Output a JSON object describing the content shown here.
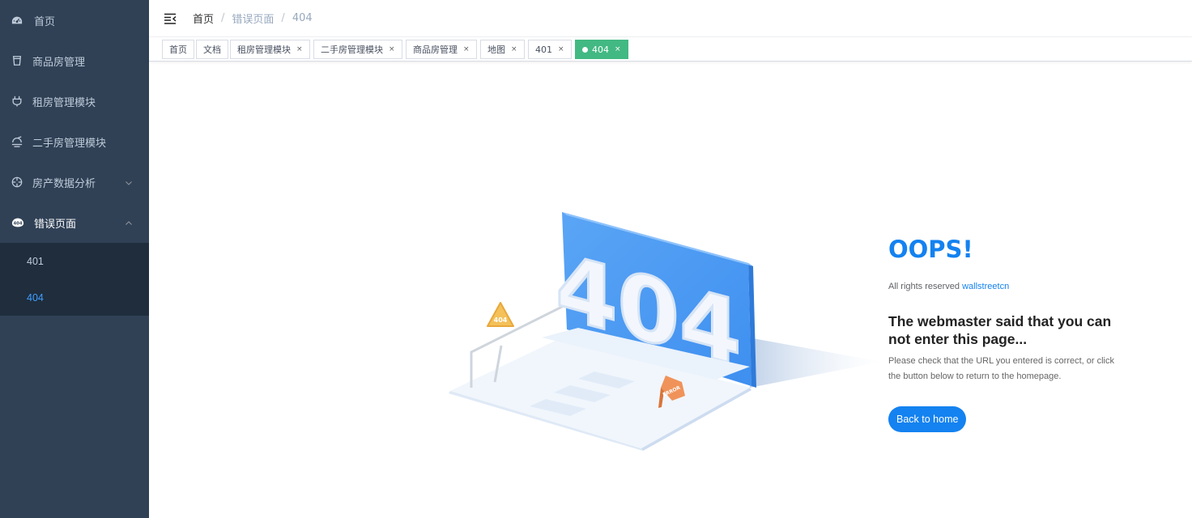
{
  "sidebar": {
    "items": [
      {
        "label": "首页",
        "icon": "dashboard-icon"
      },
      {
        "label": "商品房管理",
        "icon": "cup-icon"
      },
      {
        "label": "租房管理模块",
        "icon": "plug-icon"
      },
      {
        "label": "二手房管理模块",
        "icon": "lamp-icon"
      },
      {
        "label": "房产数据分析",
        "icon": "crosshair-icon"
      },
      {
        "label": "错误页面",
        "icon": "404-icon"
      }
    ],
    "submenu": [
      {
        "label": "401"
      },
      {
        "label": "404"
      }
    ]
  },
  "navbar": {
    "breadcrumb": [
      "首页",
      "错误页面",
      "404"
    ],
    "separator": "/"
  },
  "tags": [
    {
      "label": "首页"
    },
    {
      "label": "文档"
    },
    {
      "label": "租房管理模块",
      "close": "×"
    },
    {
      "label": "二手房管理模块",
      "close": "×"
    },
    {
      "label": "商品房管理",
      "close": "×"
    },
    {
      "label": "地图",
      "close": "×"
    },
    {
      "label": "401",
      "close": "×"
    },
    {
      "label": "404",
      "close": "×"
    }
  ],
  "error_page": {
    "oops": "OOPS!",
    "rights_prefix": "All rights reserved",
    "rights_link": "wallstreetcn",
    "headline": "The webmaster said that you can not enter this page...",
    "description": "Please check that the URL you entered is correct, or click the button below to return to the homepage.",
    "button": "Back to home",
    "illustration": {
      "big_text": "404",
      "sign_text": "404",
      "error_tag": "ERROR"
    }
  },
  "colors": {
    "sidebar_bg": "#304156",
    "submenu_bg": "#1f2d3d",
    "active_link": "#409eff",
    "tag_active": "#42b983",
    "primary": "#1482f0"
  }
}
